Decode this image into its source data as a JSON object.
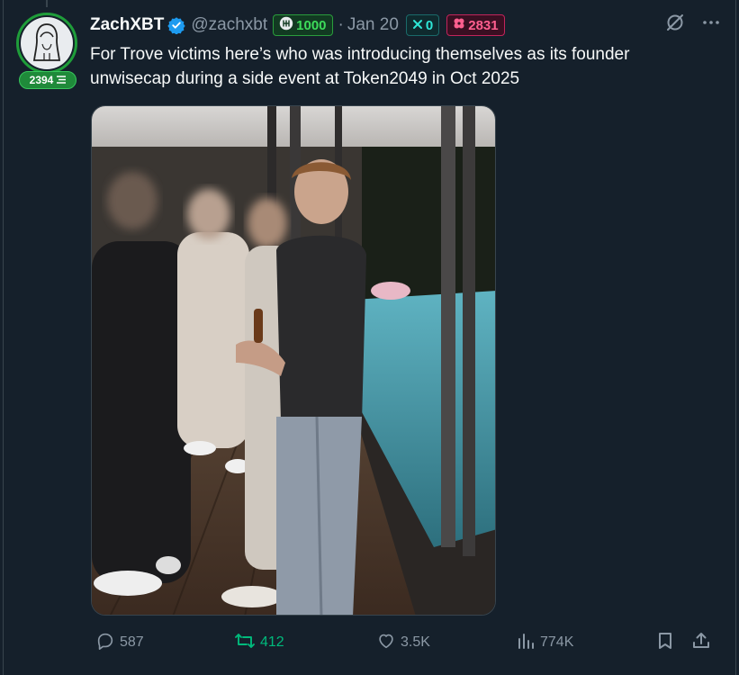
{
  "author": {
    "display_name": "ZachXBT",
    "handle": "@zachxbt",
    "verified_icon": "verified-badge-icon",
    "avatar_icon": "hooded-figure-avatar",
    "score_badge": "2394"
  },
  "badges": {
    "green": {
      "value": "1000",
      "color": "#3ddc5a"
    },
    "teal": {
      "value": "0",
      "color": "#2ee6d6"
    },
    "pink": {
      "value": "2831",
      "color": "#ff5f8f"
    }
  },
  "meta": {
    "separator": "·",
    "date": "Jan 20"
  },
  "tweet": {
    "text_lines": [
      "For Trove victims here’s who was introducing themselves as its founder",
      "unwisecap during a side event at Token2049 in Oct 2025"
    ]
  },
  "media": {
    "type": "video-thumbnail",
    "scene": "people standing on a wooden deck beside a night pool"
  },
  "actions": {
    "replies": "587",
    "retweets": "412",
    "likes": "3.5K",
    "views": "774K"
  },
  "colors": {
    "background": "#15202b",
    "text_primary": "#f7f9f9",
    "text_secondary": "#8b98a5",
    "verified": "#1d9bf0",
    "retweet": "#00ba7c",
    "avatar_ring": "#1f9d3a"
  }
}
